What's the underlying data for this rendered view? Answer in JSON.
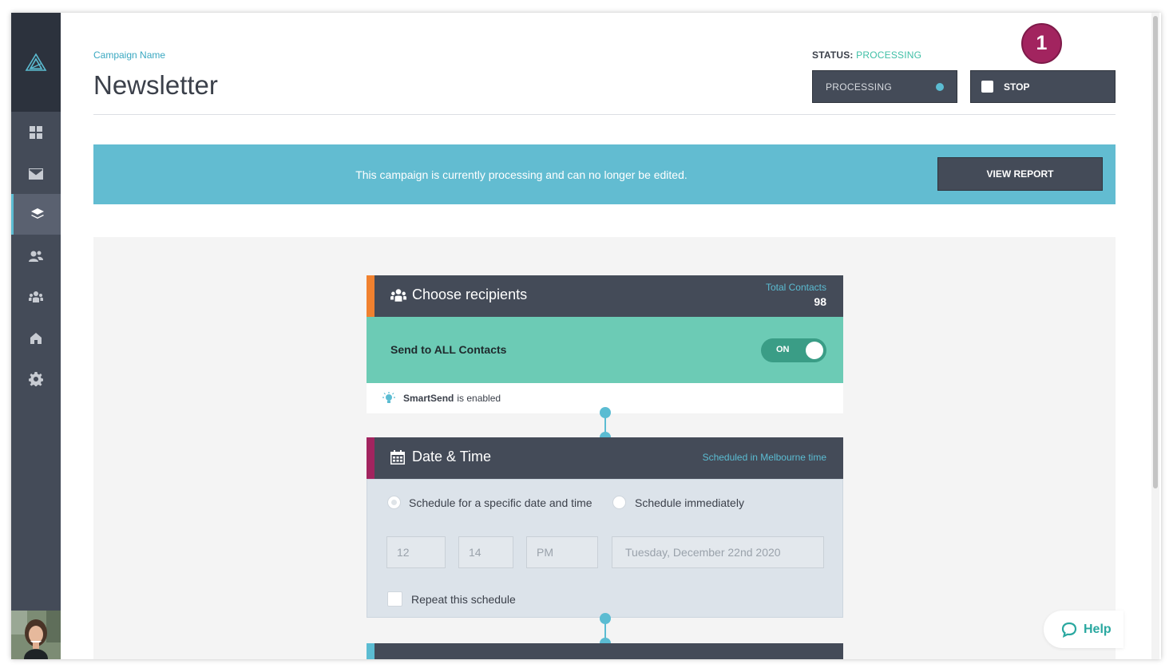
{
  "header": {
    "campaign_label": "Campaign Name",
    "title": "Newsletter",
    "status_label": "STATUS:",
    "status_value": "PROCESSING",
    "processing_button": "PROCESSING",
    "stop_button": "STOP",
    "step_badge": "1"
  },
  "banner": {
    "message": "This campaign is currently processing and can no longer be edited.",
    "button": "VIEW REPORT"
  },
  "recipients": {
    "title": "Choose recipients",
    "total_label": "Total Contacts",
    "total_value": "98",
    "send_all_label": "Send to ALL Contacts",
    "toggle_label": "ON",
    "smartsend_bold": "SmartSend",
    "smartsend_rest": "is enabled"
  },
  "datetime": {
    "title": "Date & Time",
    "timezone_note": "Scheduled in Melbourne time",
    "option_specific": "Schedule for a specific date and time",
    "option_immediate": "Schedule immediately",
    "hour": "12",
    "minute": "14",
    "ampm": "PM",
    "date": "Tuesday, December 22nd 2020",
    "repeat_label": "Repeat this schedule"
  },
  "help": {
    "label": "Help"
  },
  "colors": {
    "sidebar": "#444b58",
    "accent_blue": "#5bbcd2",
    "accent_teal": "#6ccbb5",
    "accent_orange": "#f0812f",
    "accent_magenta": "#a2245f",
    "badge": "#a2245f"
  },
  "sidebar": {
    "icons": [
      "logo-icon",
      "dashboard-icon",
      "mail-icon",
      "layers-icon",
      "contacts-icon",
      "groups-icon",
      "home-icon",
      "settings-icon"
    ]
  }
}
